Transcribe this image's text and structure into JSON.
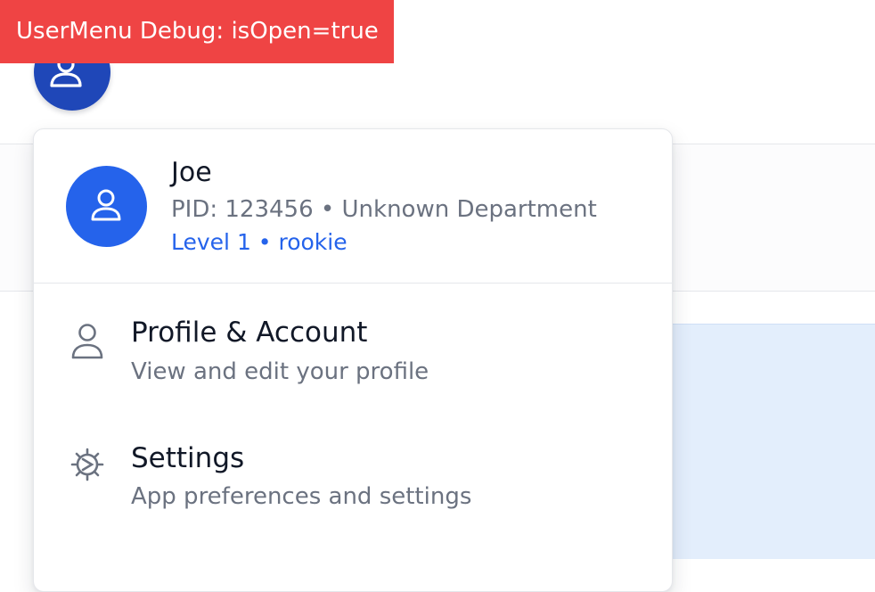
{
  "debug": {
    "label": "UserMenu Debug: isOpen=true"
  },
  "header": {
    "avatar_icon": "user-icon",
    "caret_icon": "chevron-up-icon",
    "menu_open": true
  },
  "user": {
    "name": "Joe",
    "meta": "PID: 123456 • Unknown Department",
    "level": "Level 1 • rookie"
  },
  "menu": {
    "items": [
      {
        "icon": "user-outline-icon",
        "title": "Profile & Account",
        "description": "View and edit your profile"
      },
      {
        "icon": "gear-icon",
        "title": "Settings",
        "description": "App preferences and settings"
      }
    ]
  },
  "colors": {
    "debug_banner": "#ef4444",
    "header_avatar": "#1f47b8",
    "menu_avatar": "#2563eb",
    "level_text": "#2563eb",
    "muted_text": "#6b7280",
    "primary_text": "#111827",
    "background_panel": "#e3eefc"
  }
}
